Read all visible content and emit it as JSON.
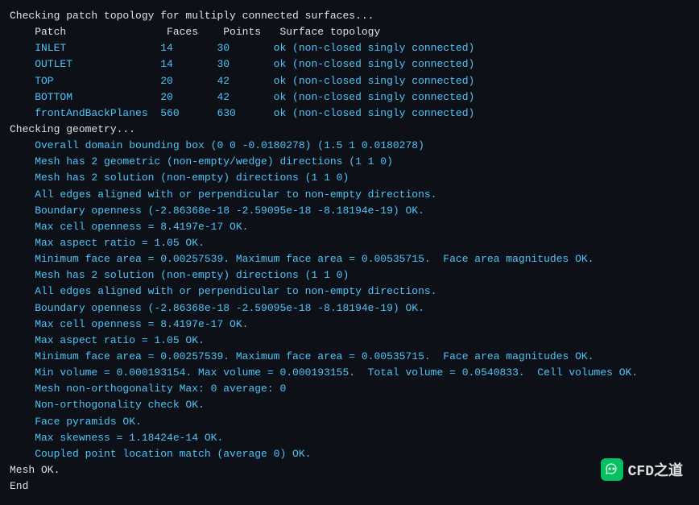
{
  "terminal": {
    "lines": [
      {
        "text": "Checking patch topology for multiply connected surfaces...",
        "color": "white"
      },
      {
        "text": "    Patch                Faces    Points   Surface topology",
        "color": "white"
      },
      {
        "text": "    INLET               14       30       ok (non-closed singly connected)",
        "color": "cyan"
      },
      {
        "text": "    OUTLET              14       30       ok (non-closed singly connected)",
        "color": "cyan"
      },
      {
        "text": "    TOP                 20       42       ok (non-closed singly connected)",
        "color": "cyan"
      },
      {
        "text": "    BOTTOM              20       42       ok (non-closed singly connected)",
        "color": "cyan"
      },
      {
        "text": "    frontAndBackPlanes  560      630      ok (non-closed singly connected)",
        "color": "cyan"
      },
      {
        "text": "",
        "color": "white"
      },
      {
        "text": "Checking geometry...",
        "color": "white"
      },
      {
        "text": "    Overall domain bounding box (0 0 -0.0180278) (1.5 1 0.0180278)",
        "color": "cyan"
      },
      {
        "text": "    Mesh has 2 geometric (non-empty/wedge) directions (1 1 0)",
        "color": "cyan"
      },
      {
        "text": "    Mesh has 2 solution (non-empty) directions (1 1 0)",
        "color": "cyan"
      },
      {
        "text": "    All edges aligned with or perpendicular to non-empty directions.",
        "color": "cyan"
      },
      {
        "text": "    Boundary openness (-2.86368e-18 -2.59095e-18 -8.18194e-19) OK.",
        "color": "cyan"
      },
      {
        "text": "    Max cell openness = 8.4197e-17 OK.",
        "color": "cyan"
      },
      {
        "text": "    Max aspect ratio = 1.05 OK.",
        "color": "cyan"
      },
      {
        "text": "    Minimum face area = 0.00257539. Maximum face area = 0.00535715.  Face area magnitudes OK.",
        "color": "cyan"
      },
      {
        "text": "    Mesh has 2 solution (non-empty) directions (1 1 0)",
        "color": "cyan"
      },
      {
        "text": "    All edges aligned with or perpendicular to non-empty directions.",
        "color": "cyan"
      },
      {
        "text": "    Boundary openness (-2.86368e-18 -2.59095e-18 -8.18194e-19) OK.",
        "color": "cyan"
      },
      {
        "text": "    Max cell openness = 8.4197e-17 OK.",
        "color": "cyan"
      },
      {
        "text": "    Max aspect ratio = 1.05 OK.",
        "color": "cyan"
      },
      {
        "text": "    Minimum face area = 0.00257539. Maximum face area = 0.00535715.  Face area magnitudes OK.",
        "color": "cyan"
      },
      {
        "text": "    Min volume = 0.000193154. Max volume = 0.000193155.  Total volume = 0.0540833.  Cell volumes OK.",
        "color": "cyan"
      },
      {
        "text": "    Mesh non-orthogonality Max: 0 average: 0",
        "color": "cyan"
      },
      {
        "text": "    Non-orthogonality check OK.",
        "color": "cyan"
      },
      {
        "text": "    Face pyramids OK.",
        "color": "cyan"
      },
      {
        "text": "    Max skewness = 1.18424e-14 OK.",
        "color": "cyan"
      },
      {
        "text": "    Coupled point location match (average 0) OK.",
        "color": "cyan"
      },
      {
        "text": "",
        "color": "white"
      },
      {
        "text": "Mesh OK.",
        "color": "white"
      },
      {
        "text": "",
        "color": "white"
      },
      {
        "text": "End",
        "color": "white"
      }
    ]
  },
  "watermark": {
    "icon_text": "W",
    "label": "CFD之道"
  }
}
